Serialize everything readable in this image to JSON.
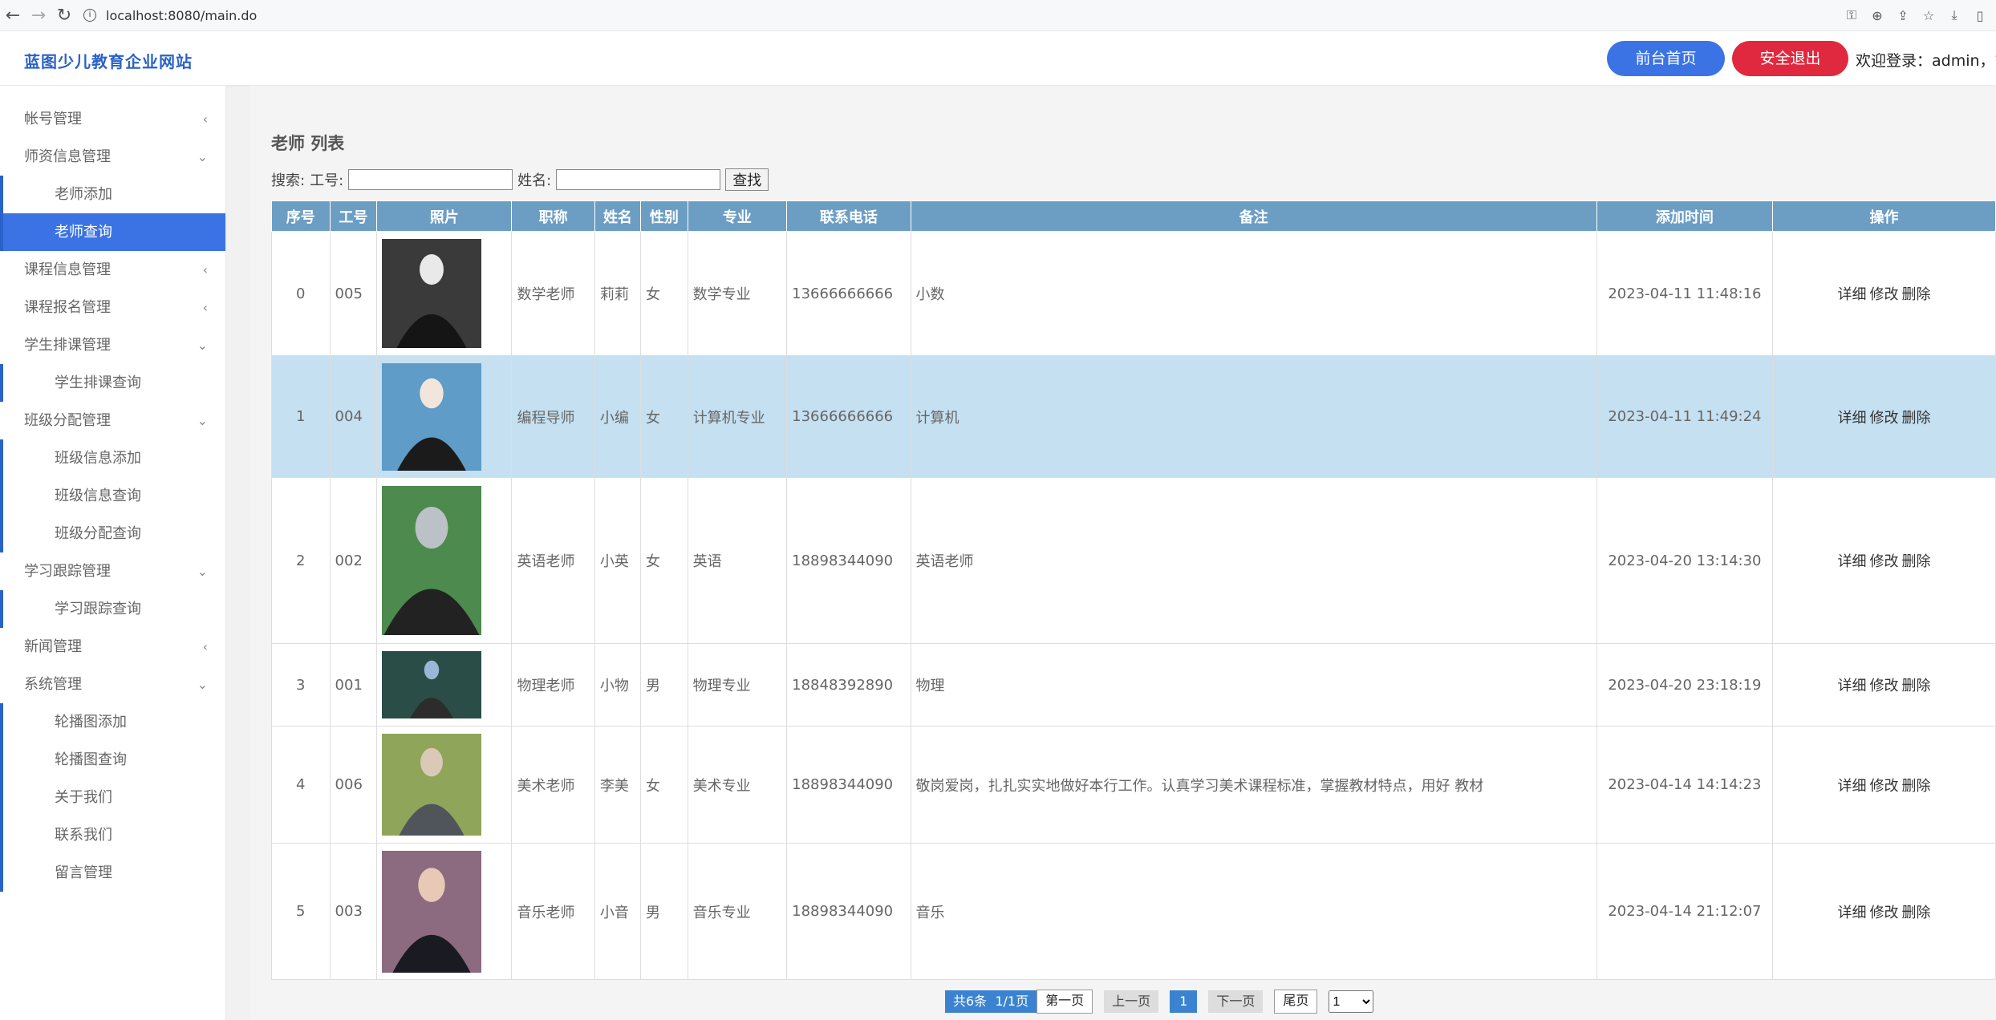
{
  "browser": {
    "url": "localhost:8080/main.do"
  },
  "header": {
    "brand": "蓝图少儿教育企业网站",
    "front_button": "前台首页",
    "logout_button": "安全退出",
    "welcome": "欢迎登录：admin，管"
  },
  "sidebar": {
    "items": [
      {
        "label": "帐号管理",
        "type": "parent",
        "chevron": "‹"
      },
      {
        "label": "师资信息管理",
        "type": "parent",
        "chevron": "⌄"
      },
      {
        "label": "老师添加",
        "type": "child"
      },
      {
        "label": "老师查询",
        "type": "child",
        "active": true
      },
      {
        "label": "课程信息管理",
        "type": "parent",
        "chevron": "‹"
      },
      {
        "label": "课程报名管理",
        "type": "parent",
        "chevron": "‹"
      },
      {
        "label": "学生排课管理",
        "type": "parent",
        "chevron": "⌄"
      },
      {
        "label": "学生排课查询",
        "type": "child"
      },
      {
        "label": "班级分配管理",
        "type": "parent",
        "chevron": "⌄"
      },
      {
        "label": "班级信息添加",
        "type": "child"
      },
      {
        "label": "班级信息查询",
        "type": "child"
      },
      {
        "label": "班级分配查询",
        "type": "child"
      },
      {
        "label": "学习跟踪管理",
        "type": "parent",
        "chevron": "⌄"
      },
      {
        "label": "学习跟踪查询",
        "type": "child"
      },
      {
        "label": "新闻管理",
        "type": "parent",
        "chevron": "‹"
      },
      {
        "label": "系统管理",
        "type": "parent",
        "chevron": "⌄"
      },
      {
        "label": "轮播图添加",
        "type": "child"
      },
      {
        "label": "轮播图查询",
        "type": "child"
      },
      {
        "label": "关于我们",
        "type": "child"
      },
      {
        "label": "联系我们",
        "type": "child"
      },
      {
        "label": "留言管理",
        "type": "child"
      }
    ]
  },
  "main": {
    "title": "老师 列表",
    "search": {
      "label": "搜索:",
      "id_label": "工号:",
      "name_label": "姓名:",
      "submit": "查找"
    },
    "table": {
      "headers": [
        "序号",
        "工号",
        "照片",
        "职称",
        "姓名",
        "性别",
        "专业",
        "联系电话",
        "备注",
        "添加时间",
        "操作"
      ],
      "rows": [
        {
          "idx": "0",
          "id": "005",
          "title": "数学老师",
          "name": "莉莉",
          "sex": "女",
          "major": "数学专业",
          "phone": "13666666666",
          "note": "小数",
          "time": "2023-04-11 11:48:16",
          "photo_colors": [
            "#3a3a3a",
            "#e9e9e9",
            "#151515"
          ]
        },
        {
          "idx": "1",
          "id": "004",
          "title": "编程导师",
          "name": "小编",
          "sex": "女",
          "major": "计算机专业",
          "phone": "13666666666",
          "note": "计算机",
          "time": "2023-04-11 11:49:24",
          "photo_colors": [
            "#5f9cc7",
            "#f2e6dc",
            "#1b1b1b"
          ]
        },
        {
          "idx": "2",
          "id": "002",
          "title": "英语老师",
          "name": "小英",
          "sex": "女",
          "major": "英语",
          "phone": "18898344090",
          "note": "英语老师",
          "time": "2023-04-20 13:14:30",
          "photo_colors": [
            "#4c8a4e",
            "#bcc0c7",
            "#222"
          ]
        },
        {
          "idx": "3",
          "id": "001",
          "title": "物理老师",
          "name": "小物",
          "sex": "男",
          "major": "物理专业",
          "phone": "18848392890",
          "note": "物理",
          "time": "2023-04-20 23:18:19",
          "photo_colors": [
            "#2b4d47",
            "#9bb6d6",
            "#2c2c2c"
          ]
        },
        {
          "idx": "4",
          "id": "006",
          "title": "美术老师",
          "name": "李美",
          "sex": "女",
          "major": "美术专业",
          "phone": "18898344090",
          "note": "敬岗爱岗，扎扎实实地做好本行工作。认真学习美术课程标准，掌握教材特点，用好 教材",
          "time": "2023-04-14 14:14:23",
          "photo_colors": [
            "#8ea55a",
            "#d9c9b6",
            "#50555c"
          ]
        },
        {
          "idx": "5",
          "id": "003",
          "title": "音乐老师",
          "name": "小音",
          "sex": "男",
          "major": "音乐专业",
          "phone": "18898344090",
          "note": "音乐",
          "time": "2023-04-14 21:12:07",
          "photo_colors": [
            "#8c6a80",
            "#e8c9b6",
            "#1a1a22"
          ]
        }
      ],
      "actions": [
        "详细",
        "修改",
        "删除"
      ]
    },
    "pager": {
      "total": "共6条",
      "pages": "1/1页",
      "first": "第一页",
      "prev": "上一页",
      "current": "1",
      "next": "下一页",
      "last": "尾页",
      "select_value": "1"
    }
  }
}
